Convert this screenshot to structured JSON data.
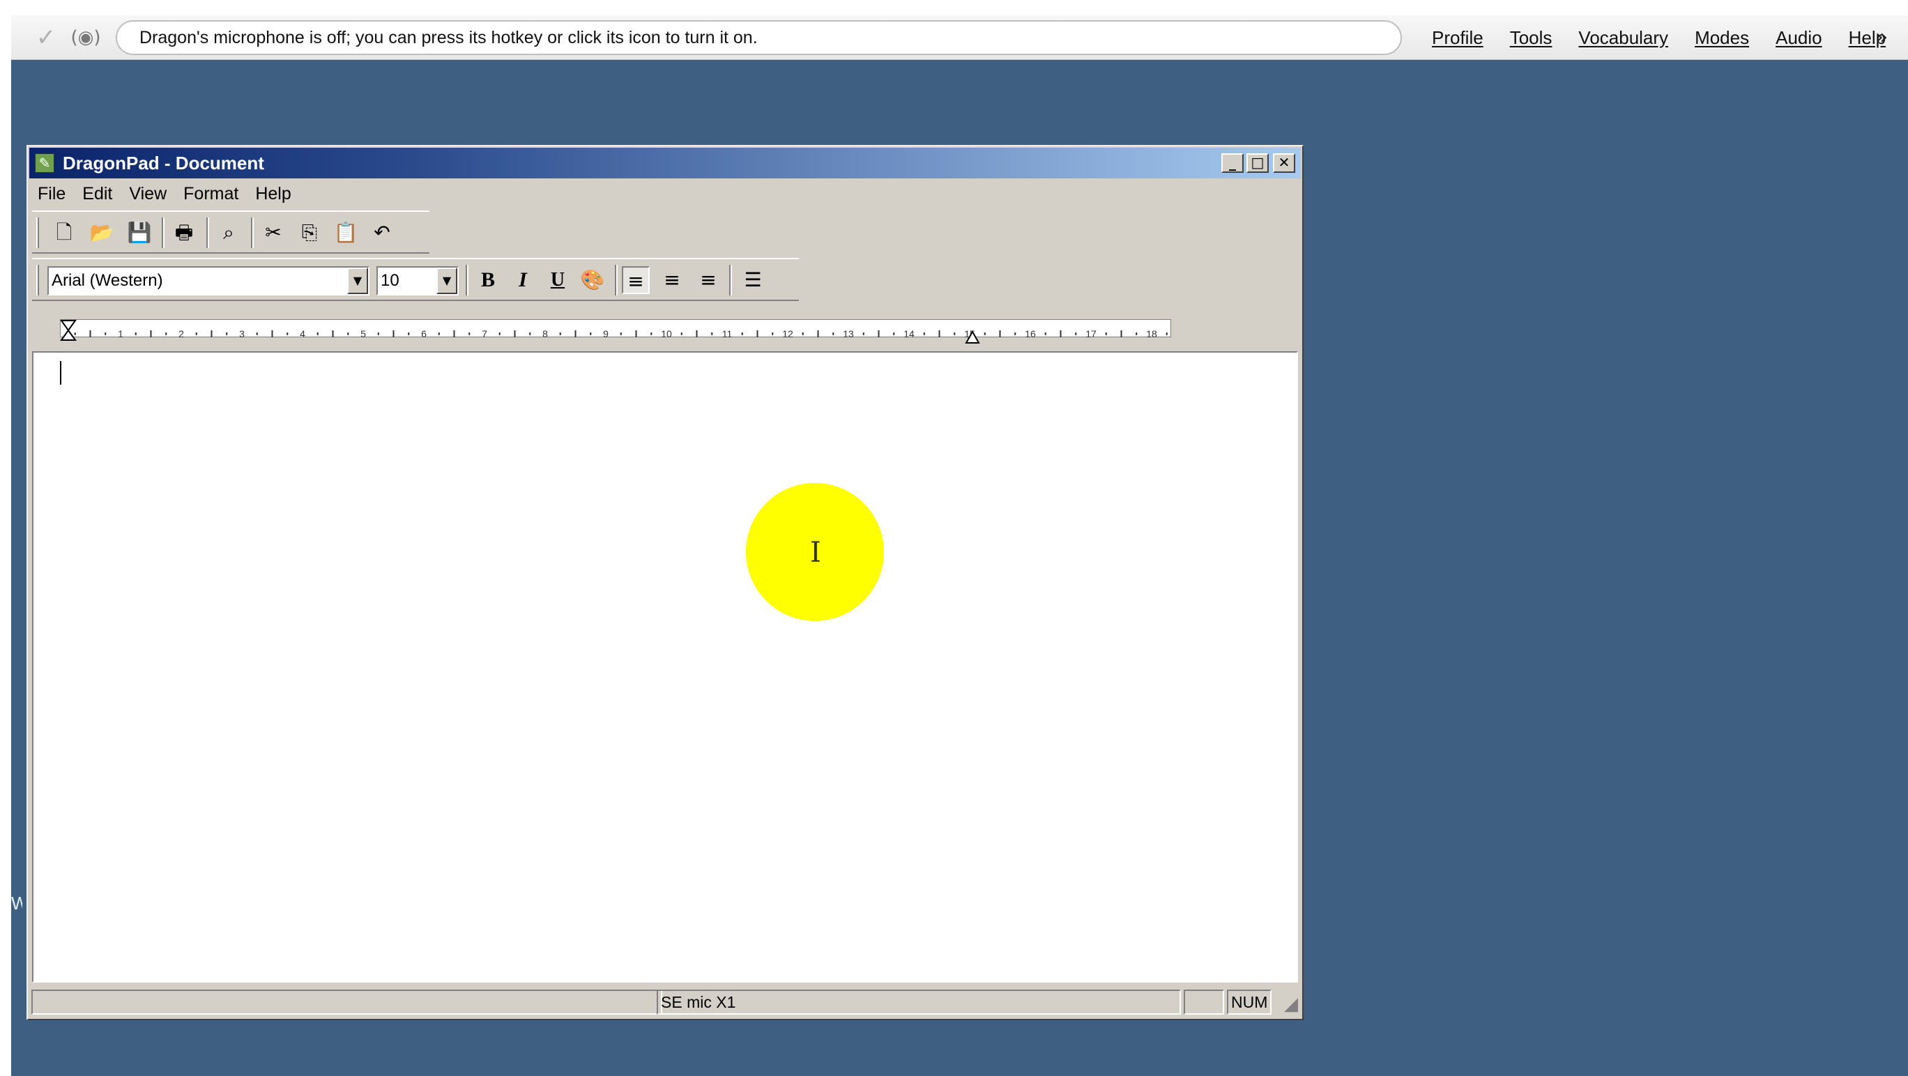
{
  "dragon_bar": {
    "status_message": "Dragon's microphone is off; you can press its hotkey or click its icon to turn it on.",
    "menu": [
      "Profile",
      "Tools",
      "Vocabulary",
      "Modes",
      "Audio",
      "Help"
    ],
    "check_icon": "✓",
    "mic_icon": "(◉)",
    "more_icon": "»"
  },
  "window": {
    "title": "DragonPad - Document",
    "caption_buttons": {
      "minimize": "_",
      "maximize": "□",
      "close": "✕"
    },
    "menu": [
      "File",
      "Edit",
      "View",
      "Format",
      "Help"
    ],
    "standard_toolbar": {
      "icons": [
        "new-document-icon",
        "open-folder-icon",
        "save-disk-icon",
        "print-icon",
        "find-binoculars-icon",
        "cut-scissors-icon",
        "copy-icon",
        "paste-icon",
        "undo-icon"
      ],
      "glyphs": [
        "🗋",
        "📂",
        "💾",
        "🖶",
        "⌕",
        "✂",
        "⎘",
        "📋",
        "↶"
      ]
    },
    "format_toolbar": {
      "font_name": "Arial (Western)",
      "font_size": "10",
      "bold": "B",
      "italic": "I",
      "underline": "U",
      "color_glyph": "🎨",
      "align_left_glyph": "≡",
      "align_center_glyph": "≡",
      "align_right_glyph": "≡",
      "bullets_glyph": "☰"
    },
    "ruler": {
      "labels": [
        "1",
        "2",
        "3",
        "4",
        "5",
        "6",
        "7",
        "8",
        "9",
        "10",
        "11",
        "12",
        "13",
        "14",
        "15",
        "16",
        "17",
        "18"
      ]
    },
    "status_bar": {
      "mic_label": "SE mic X1",
      "blank_panel": "",
      "num_lock": "NUM"
    }
  },
  "desktop": {
    "edge_glyph": "W"
  },
  "cursor": {
    "ibeam_glyph": "I"
  },
  "colors": {
    "desktop": "#3e5f82",
    "titlebar_start": "#0a246a",
    "titlebar_end": "#a6caf0",
    "window_face": "#d4d0c8",
    "highlight": "#ffff00"
  }
}
